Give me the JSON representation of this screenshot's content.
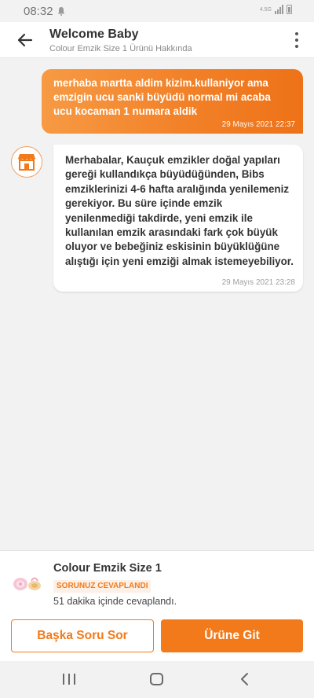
{
  "status_bar": {
    "time": "08:32",
    "network_label": "4.5G",
    "icons": [
      "notification-icon",
      "signal-icon",
      "battery-icon"
    ]
  },
  "header": {
    "title": "Welcome Baby",
    "subtitle": "Colour Emzik Size 1 Ürünü Hakkında",
    "icons": [
      "back-arrow-icon",
      "more-vertical-icon"
    ]
  },
  "conversation": {
    "user_message": {
      "text": "merhaba martta aldim kizim.kullaniyor ama emzigin ucu sanki büyüdü normal mi acaba ucu kocaman 1 numara aldik",
      "time": "29 Mayıs 2021 22:37"
    },
    "seller_message": {
      "avatar_icon": "store-icon",
      "text": "Merhabalar, Kauçuk emzikler doğal yapıları gereği kullandıkça büyüdüğünden, Bibs emziklerinizi 4-6 hafta aralığında yenilemeniz gerekiyor. Bu süre içinde emzik yenilenmediği takdirde, yeni emzik ile kullanılan emzik arasındaki fark çok büyük oluyor ve bebeğiniz eskisinin büyüklüğüne alıştığı için yeni emziği almak istemeyebiliyor.",
      "time": "29 Mayıs 2021 23:28"
    }
  },
  "product": {
    "name": "Colour Emzik Size 1",
    "badge": "SORUNUZ CEVAPLANDI",
    "answer_time": "51 dakika içinde cevaplandı.",
    "thumbnail_icon": "pacifier-icon"
  },
  "actions": {
    "ask_another": "Başka Soru Sor",
    "go_to_product": "Ürüne Git"
  },
  "nav": {
    "icons": [
      "recent-apps-icon",
      "home-icon",
      "back-icon"
    ]
  },
  "colors": {
    "accent": "#f27a1a",
    "bubble_gradient_start": "#f79a44",
    "bubble_gradient_end": "#ee7218",
    "badge_bg": "#fdf0e6",
    "background": "#f2f2f2"
  }
}
